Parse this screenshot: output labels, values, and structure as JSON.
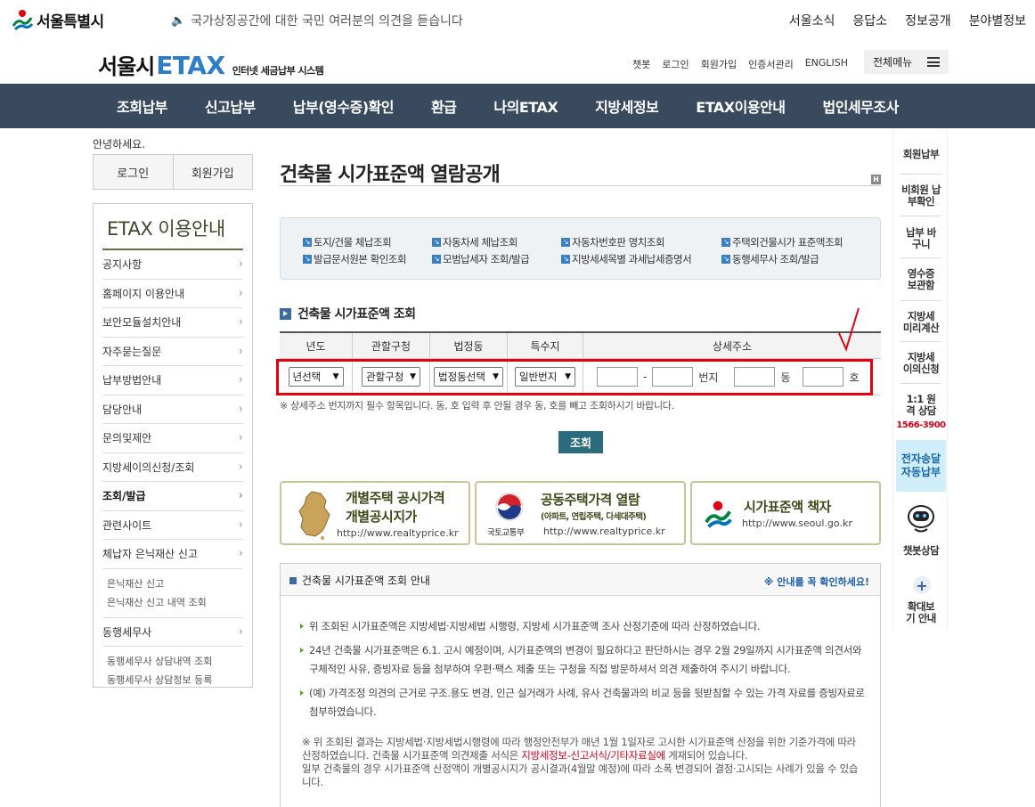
{
  "topbar": {
    "logo_text": "서울특별시",
    "slogan": "국가상징공간에 대한 국민 여러분의 의견을 듣습니다",
    "links": [
      "서울소식",
      "응답소",
      "정보공개",
      "분야별정보"
    ]
  },
  "header": {
    "brand_main": "서울시",
    "brand_accent": "ETAX",
    "brand_sub": "인터넷 세금납부 시스템",
    "links": [
      "챗봇",
      "로그인",
      "회원가입",
      "인증서관리",
      "ENGLISH"
    ],
    "allmenu_label": "전체메뉴"
  },
  "gnb": [
    "조회납부",
    "신고납부",
    "납부(영수증)확인",
    "환급",
    "나의ETAX",
    "지방세정보",
    "ETAX이용안내",
    "법인세무조사"
  ],
  "sidebar": {
    "greeting": "안녕하세요.",
    "login": "로그인",
    "signup": "회원가입",
    "title": "ETAX 이용안내",
    "items": [
      "공지사항",
      "홈페이지 이용안내",
      "보안모듈설치안내",
      "자주묻는질문",
      "납부방법안내",
      "담당안내",
      "문의및제안",
      "지방세이의신청/조회",
      "조회/발급",
      "관련사이트",
      "체납자 은닉재산 신고"
    ],
    "sub1": [
      "은닉재산 신고",
      "은닉재산 신고 내역 조회"
    ],
    "item_last": "동행세무사",
    "sub2": [
      "동행세무사 상담내역 조회",
      "동행세무사 상담정보 등록"
    ]
  },
  "main": {
    "title": "건축물 시가표준액 열람공개",
    "quicklinks": [
      "토지/건물 체납조회",
      "자동차세 체납조회",
      "자동차번호판 영치조회",
      "주택외건물시가 표준액조회",
      "발급문서원본 확인조회",
      "모범납세자 조회/발급",
      "지방세세목별 과세납세증명서",
      "동행세무사 조회/발급"
    ],
    "section_title": "건축물 시가표준액 조회",
    "table": {
      "headers": [
        "년도",
        "관할구청",
        "법정동",
        "특수지",
        "상세주소"
      ],
      "year": "년선택",
      "gu": "관할구청",
      "dong": "법정동선택",
      "special": "일반번지",
      "beonji": "번지",
      "dong_unit": "동",
      "ho_unit": "호"
    },
    "note": "※ 상세주소 번지까지 필수 항목입니다. 동, 호 입력 후 안될 경우 동, 호를 빼고 조회하시기 바랍니다.",
    "search_button": "조회",
    "banners": {
      "b1_title1": "개별주택 공시가격",
      "b1_title2": "개별공시지가",
      "b1_url": "http://www.realtyprice.kr",
      "b2_title": "공동주택가격 열람",
      "b2_sub": "(아파트, 연립주택, 다세대주택)",
      "b2_org": "국토교통부",
      "b2_url": "http://www.realtyprice.kr",
      "b3_title": "시가표준액 책자",
      "b3_url": "http://www.seoul.go.kr"
    },
    "info": {
      "title": "건축물 시가표준액 조회 안내",
      "note": "※ 안내를 꼭 확인하세요!",
      "bullets": [
        "위 조회된 시가표준액은 지방세법·지방세법 시행령, 지방세 시가표준액 조사 산정기준에 따라 산정하였습니다.",
        "24년 건축물 시가표준액은 6.1. 고시 예정이며, 시가표준액의 변경이 필요하다고 판단하시는 경우 2월 29일까지 시가표준액 의견서와 구체적인 사유, 증빙자료 등을 첨부하여 우편·팩스 제출 또는 구청을 직접 방문하셔서 의견 제출하여 주시기 바랍니다.",
        "(예) 가격조정 의견의 근거로 구조.용도 변경, 인근 실거래가 사례, 유사 건축물과의 비교 등을 뒷받침할 수 있는 가격 자료를 증빙자료로 첨부하였습니다."
      ],
      "small_note_1": "※ 위 조회된 결과는 지방세법·지방세법시행령에 따라 행정안전부가 매년 1월 1일자로 고시한 시가표준액 산정을 위한 기준가격에 따라 산정하였습니다. 건축물 시가표준액 의견제출 서식은 ",
      "small_note_red": "지방세정보-신고서식/기타자료실에",
      "small_note_2": " 게재되어 있습니다.",
      "small_note_3": "일부 건축물의 경우 시가표준액 산정액이 개별공시지가 공시결과(4월말 예정)에 따라 소폭 변경되어 결정·고시되는 사례가 있을 수 있습니다."
    }
  },
  "quickmenu": {
    "items": [
      "회원납부",
      "비회원 납부확인",
      "납부 바구니",
      "영수증 보관함",
      "지방세 미리계산",
      "지방세 이의신청",
      "1:1 원격 상담"
    ],
    "phone": "1566-3900",
    "etax": "전자송달 자동납부",
    "chatbot": "챗봇상담",
    "zoom": "확대보기 안내"
  }
}
